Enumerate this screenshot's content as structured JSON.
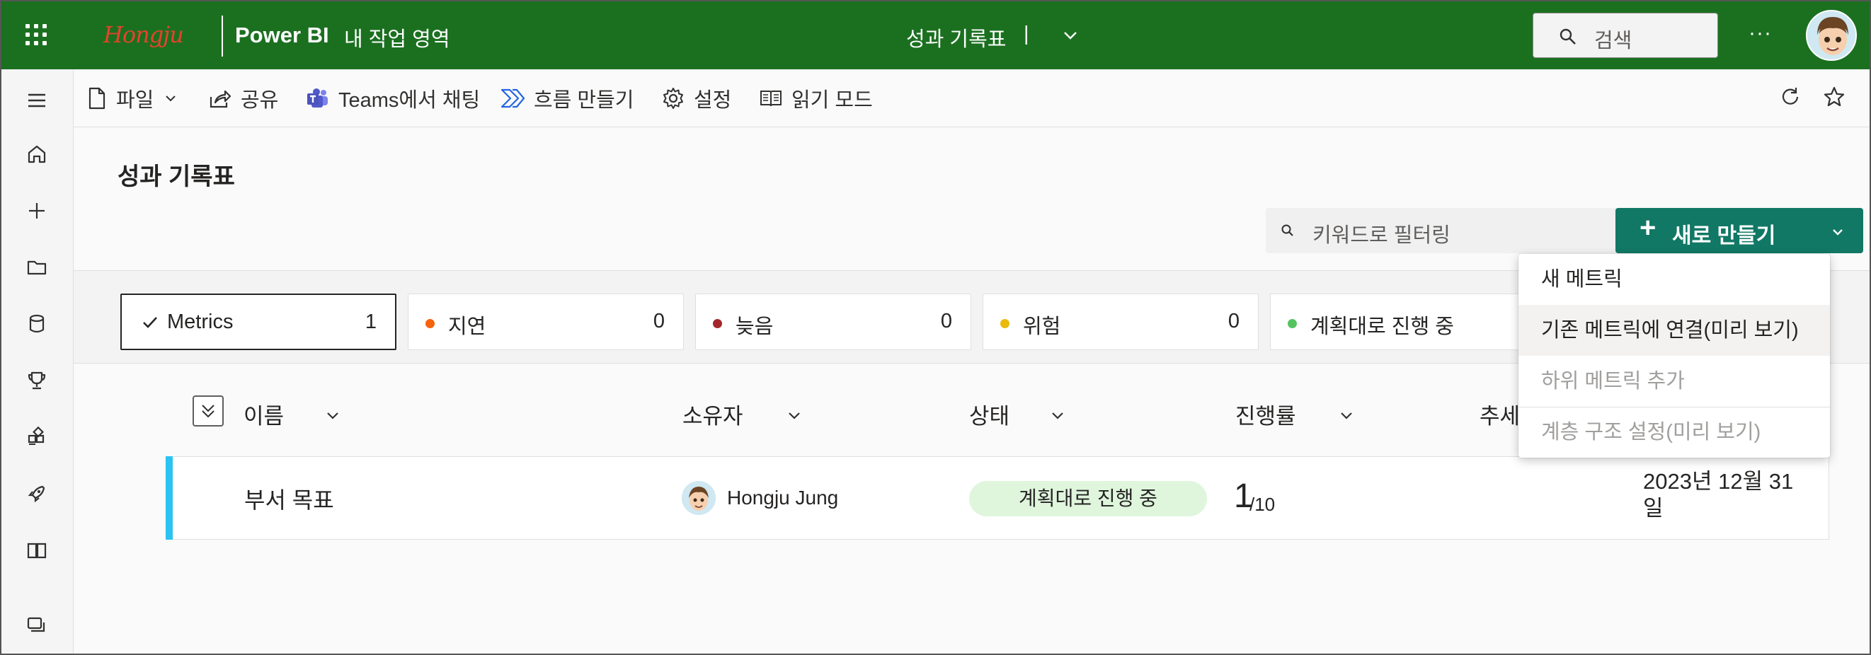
{
  "topbar": {
    "logo": "Hongju",
    "app_name": "Power BI",
    "workspace": "내 작업 영역",
    "doc_title": "성과 기록표",
    "doc_caret": "|",
    "search_placeholder": "검색",
    "more": "···",
    "bg_color": "#1b7020"
  },
  "toolbar": {
    "file": "파일",
    "share": "공유",
    "teams": "Teams에서 채팅",
    "flow": "흐름 만들기",
    "settings": "설정",
    "reading": "읽기 모드"
  },
  "main": {
    "title": "성과 기록표",
    "filter_placeholder": "키워드로 필터링",
    "new_button": "새로 만들기",
    "accent_color": "#117865"
  },
  "status_cards": [
    {
      "label": "Metrics",
      "count": "1",
      "color": ""
    },
    {
      "label": "지연",
      "count": "0",
      "color": "#f7630c"
    },
    {
      "label": "늦음",
      "count": "0",
      "color": "#a4262c"
    },
    {
      "label": "위험",
      "count": "0",
      "color": "#eaba09"
    },
    {
      "label": "계획대로 진행 중",
      "count": "",
      "color": "#54c35f"
    }
  ],
  "columns": {
    "name": "이름",
    "owner": "소유자",
    "status": "상태",
    "progress": "진행률",
    "trend": "추세"
  },
  "rows": [
    {
      "name": "부서 목표",
      "owner": "Hongju Jung",
      "status": "계획대로 진행 중",
      "progress_value": "1",
      "progress_target": "/10",
      "due": "2023년 12월 31일"
    }
  ],
  "menu": {
    "items": [
      {
        "label": "새 메트릭",
        "state": "normal"
      },
      {
        "label": "기존 메트릭에 연결(미리 보기)",
        "state": "hover"
      },
      {
        "label": "하위 메트릭 추가",
        "state": "disabled"
      },
      {
        "label": "계층 구조 설정(미리 보기)",
        "state": "disabled"
      }
    ]
  }
}
